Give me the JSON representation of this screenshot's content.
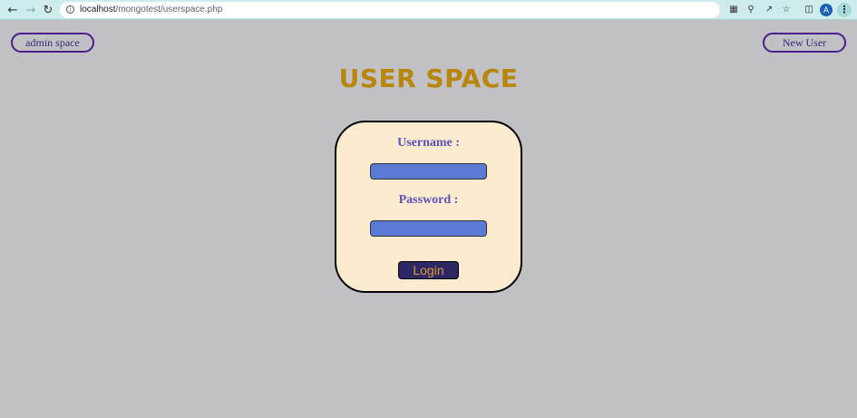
{
  "browser": {
    "url_host": "localhost",
    "url_path": "/mongotest/userspace.php",
    "profile_initial": "A"
  },
  "icons": {
    "back": "back-arrow-icon",
    "forward": "forward-arrow-icon",
    "reload": "reload-icon",
    "info": "info-icon",
    "translate": "translate-icon",
    "zoom": "zoom-icon",
    "share": "share-icon",
    "bookmark": "star-icon",
    "sidepanel": "side-panel-icon",
    "menu": "kebab-menu-icon"
  },
  "header": {
    "admin_label": "admin space",
    "new_user_label": "New User"
  },
  "main": {
    "title": "USER SPACE"
  },
  "login_form": {
    "username_label": "Username :",
    "username_value": "",
    "password_label": "Password :",
    "password_value": "",
    "submit_label": "Login"
  },
  "colors": {
    "page_bg": "#c0c0c5",
    "title": "#b8860b",
    "card_bg": "#fdebd0",
    "label": "#5a52b8",
    "input_bg": "#5b7ad6",
    "button_bg": "#2d2766",
    "button_text": "#d99a30",
    "pill_border": "#4b1f8c"
  }
}
